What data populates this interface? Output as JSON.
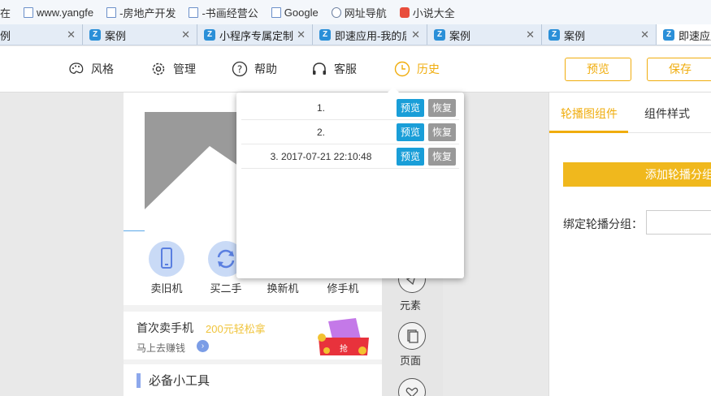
{
  "bookmarks": [
    {
      "label": "在",
      "icon": "none"
    },
    {
      "label": "www.yangfe",
      "icon": "page-icon"
    },
    {
      "label": "-房地产开发",
      "icon": "page-icon"
    },
    {
      "label": "-书画经营公",
      "icon": "page-icon"
    },
    {
      "label": "Google",
      "icon": "page-icon"
    },
    {
      "label": "网址导航",
      "icon": "globe-icon"
    },
    {
      "label": "小说大全",
      "icon": "novel-icon"
    }
  ],
  "tabs": [
    {
      "label": "例"
    },
    {
      "label": "案例"
    },
    {
      "label": "小程序专属定制"
    },
    {
      "label": "即速应用-我的后"
    },
    {
      "label": "案例"
    },
    {
      "label": "案例"
    },
    {
      "label": "即速应用"
    }
  ],
  "toolbar": {
    "style": "风格",
    "manage": "管理",
    "help": "帮助",
    "service": "客服",
    "history": "历史",
    "preview": "预览",
    "save": "保存",
    "accent": "#f0ad0e"
  },
  "phone": {
    "nav": [
      "卖旧机",
      "买二手",
      "换新机",
      "修手机"
    ],
    "sell_title": "首次卖手机",
    "sell_promo": "200元轻松拿",
    "sell_link": "马上去赚钱",
    "sell_badge": "抢",
    "tools_title": "必备小工具"
  },
  "sidebar": {
    "items": [
      "元素",
      "页面"
    ]
  },
  "panel": {
    "tab_carousel": "轮播图组件",
    "tab_style": "组件样式",
    "add_button": "添加轮播分组",
    "bind_label": "绑定轮播分组："
  },
  "history": {
    "rows": [
      {
        "text": "1."
      },
      {
        "text": "2."
      },
      {
        "text": "3. 2017-07-21 22:10:48"
      }
    ],
    "preview_label": "预览",
    "restore_label": "恢复",
    "preview_color": "#199ed8",
    "restore_color": "#999999"
  }
}
